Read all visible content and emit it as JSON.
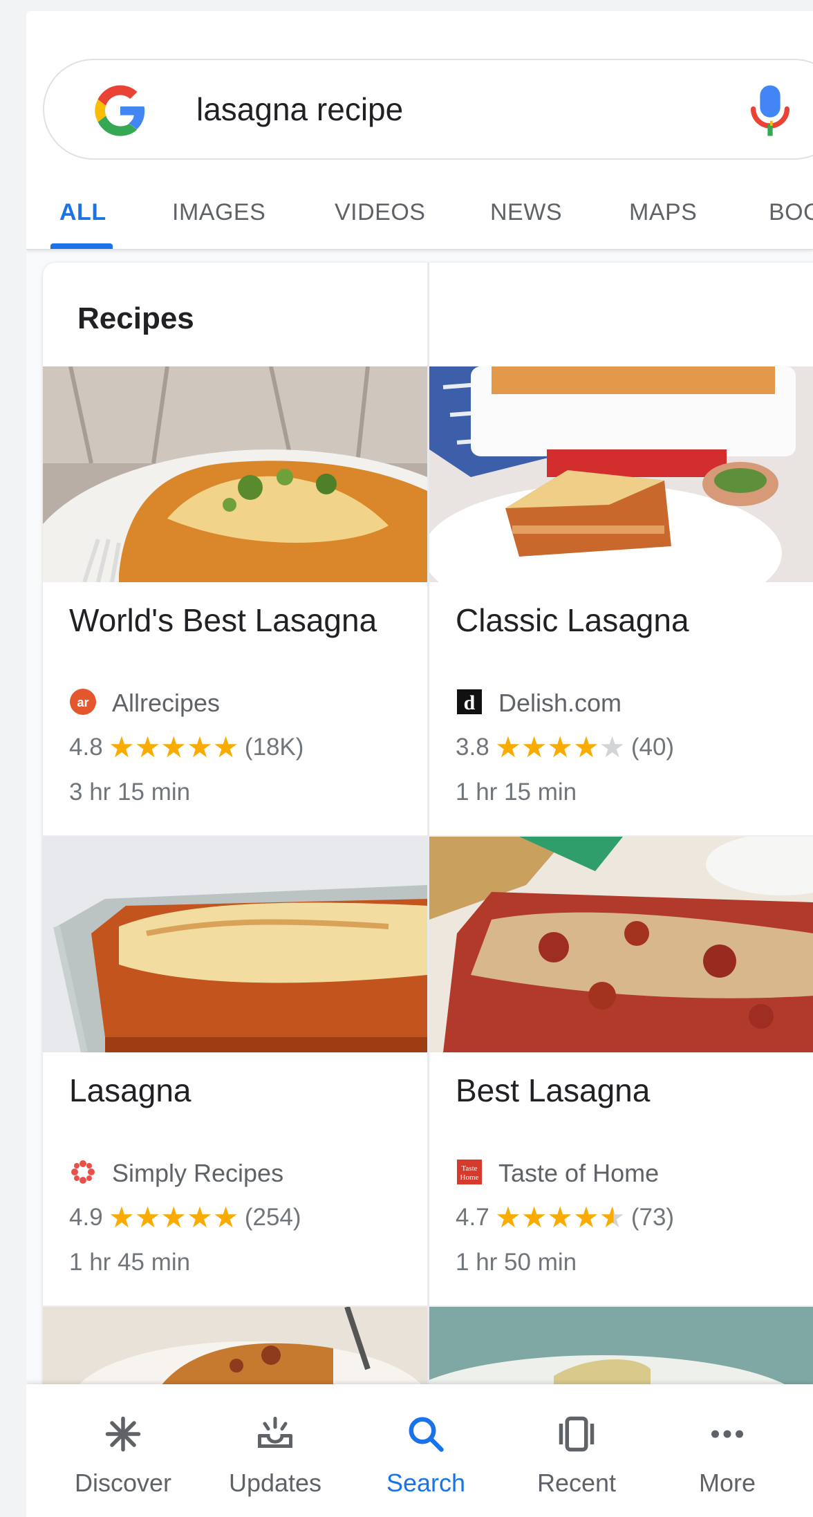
{
  "search": {
    "query": "lasagna recipe"
  },
  "tabs": [
    {
      "label": "ALL",
      "active": true
    },
    {
      "label": "IMAGES"
    },
    {
      "label": "VIDEOS"
    },
    {
      "label": "NEWS"
    },
    {
      "label": "MAPS"
    },
    {
      "label": "BOO"
    }
  ],
  "recipes": {
    "title": "Recipes",
    "items": [
      {
        "title": "World's Best Lasagna",
        "source": "Allrecipes",
        "source_icon": "allrecipes-icon",
        "rating": "4.8",
        "stars": 5,
        "count": "(18K)",
        "time": "3 hr 15 min"
      },
      {
        "title": "Classic Lasagna",
        "source": "Delish.com",
        "source_icon": "delish-icon",
        "rating": "3.8",
        "stars": 4,
        "count": "(40)",
        "time": "1 hr 15 min"
      },
      {
        "title": "Lasagna",
        "source": "Simply Recipes",
        "source_icon": "simply-recipes-icon",
        "rating": "4.9",
        "stars": 5,
        "count": "(254)",
        "time": "1 hr 45 min"
      },
      {
        "title": "Best Lasagna",
        "source": "Taste of Home",
        "source_icon": "taste-of-home-icon",
        "rating": "4.7",
        "stars": 4.5,
        "count": "(73)",
        "time": "1 hr 50 min"
      }
    ]
  },
  "bottom_nav": [
    {
      "label": "Discover",
      "icon": "asterisk-icon"
    },
    {
      "label": "Updates",
      "icon": "updates-tray-icon"
    },
    {
      "label": "Search",
      "icon": "search-icon",
      "active": true
    },
    {
      "label": "Recent",
      "icon": "recent-cards-icon"
    },
    {
      "label": "More",
      "icon": "more-dots-icon"
    }
  ],
  "colors": {
    "accent": "#1a73e8",
    "star": "#f9ab00",
    "muted": "#5f6368"
  }
}
